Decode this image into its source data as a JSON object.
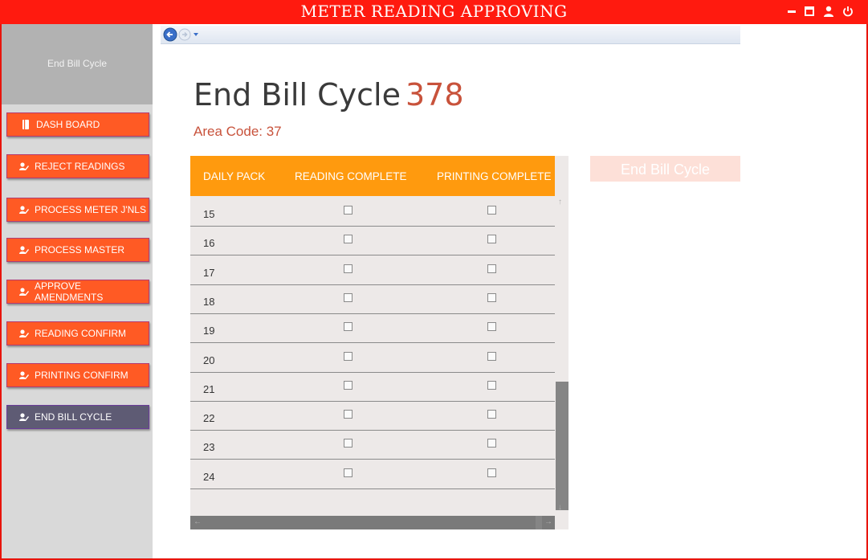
{
  "window": {
    "title": "METER READING APPROVING"
  },
  "sidebar": {
    "header": "End Bill Cycle",
    "items": [
      {
        "label": "DASH BOARD",
        "icon": "book-icon"
      },
      {
        "label": "REJECT READINGS",
        "icon": "user-edit-icon"
      },
      {
        "label": "PROCESS METER J'NLS",
        "icon": "user-edit-icon"
      },
      {
        "label": "PROCESS MASTER",
        "icon": "user-edit-icon"
      },
      {
        "label": "APPROVE AMENDMENTS",
        "icon": "user-edit-icon"
      },
      {
        "label": "READING CONFIRM",
        "icon": "user-edit-icon"
      },
      {
        "label": "PRINTING CONFIRM",
        "icon": "user-edit-icon"
      },
      {
        "label": "END BILL CYCLE",
        "icon": "user-edit-icon",
        "active": true
      }
    ]
  },
  "main": {
    "heading": "End Bill Cycle",
    "cycle_number": "378",
    "area_code": "Area Code: 37",
    "end_button": "End Bill Cycle"
  },
  "grid": {
    "columns": [
      "DAILY PACK",
      "READING COMPLETE",
      "PRINTING COMPLETE"
    ],
    "rows": [
      {
        "pack": "15",
        "reading": false,
        "printing": false
      },
      {
        "pack": "16",
        "reading": false,
        "printing": false
      },
      {
        "pack": "17",
        "reading": false,
        "printing": false
      },
      {
        "pack": "18",
        "reading": false,
        "printing": false
      },
      {
        "pack": "19",
        "reading": false,
        "printing": false
      },
      {
        "pack": "20",
        "reading": false,
        "printing": false
      },
      {
        "pack": "21",
        "reading": false,
        "printing": false
      },
      {
        "pack": "22",
        "reading": false,
        "printing": false
      },
      {
        "pack": "23",
        "reading": false,
        "printing": false
      },
      {
        "pack": "24",
        "reading": false,
        "printing": false
      }
    ]
  },
  "colors": {
    "titlebar": "#ff1a0f",
    "accent": "#ff5a24",
    "grid_header": "#ff9a0e",
    "number": "#c8523b"
  }
}
